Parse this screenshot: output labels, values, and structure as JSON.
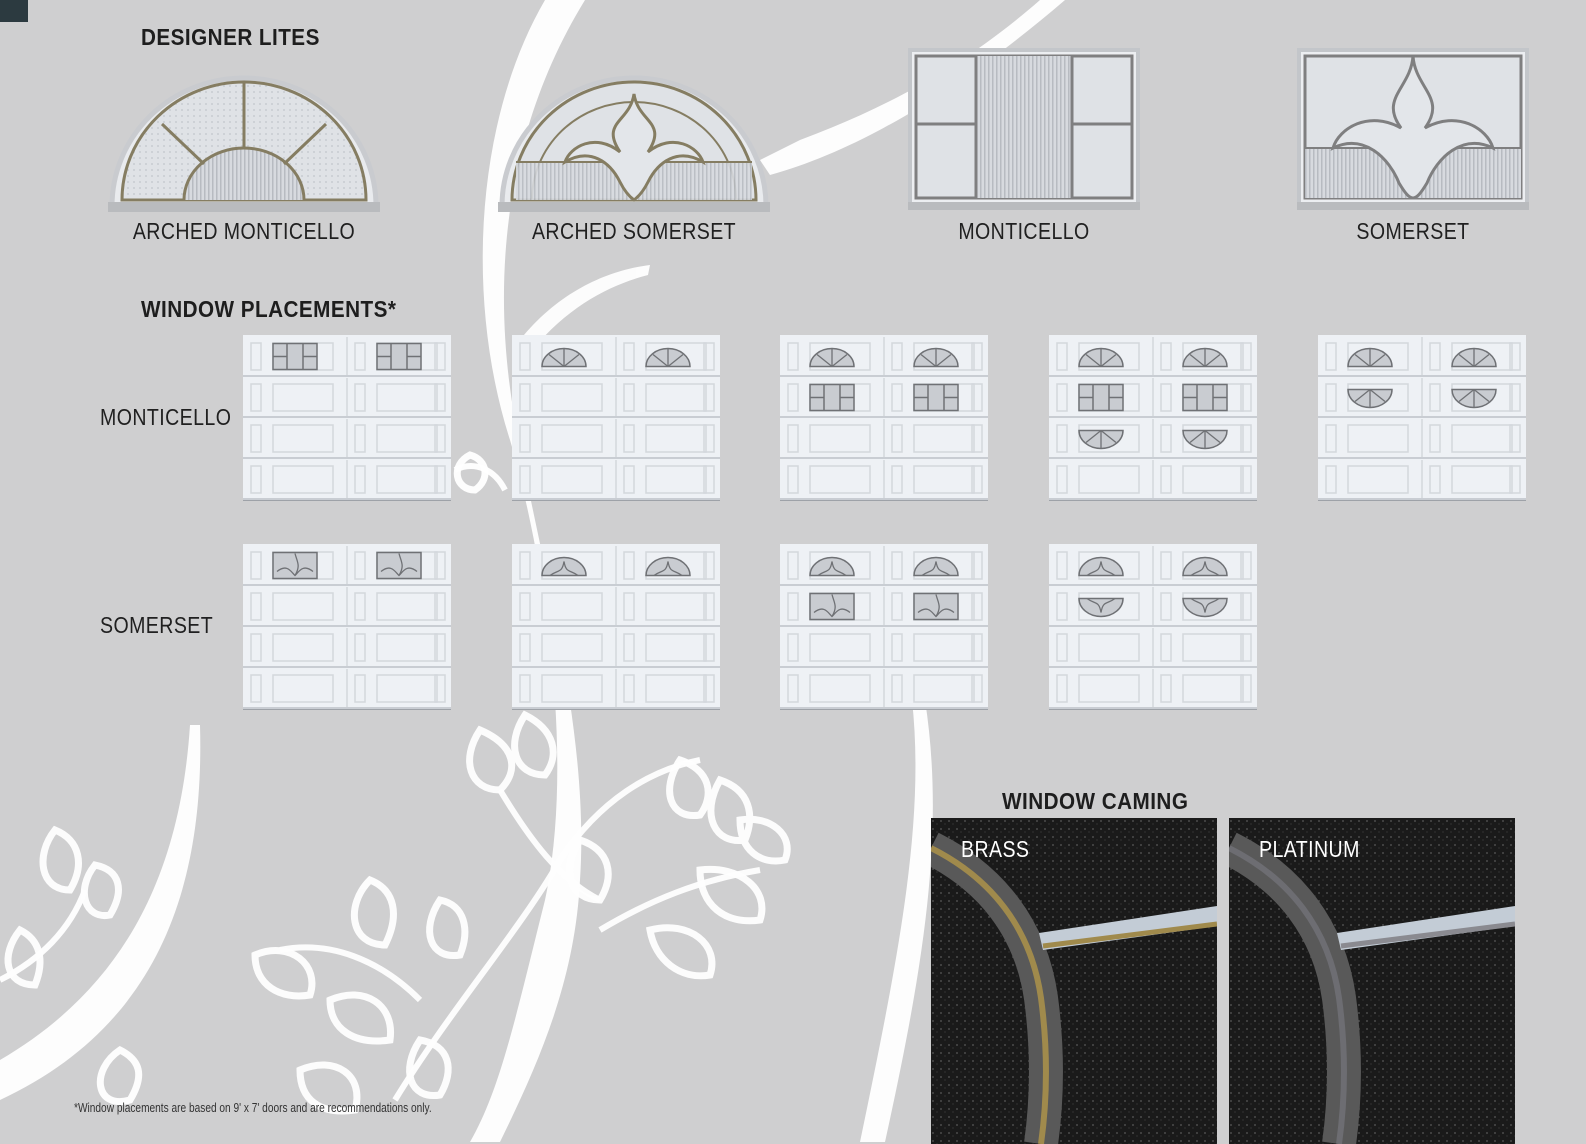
{
  "designer_lites": {
    "heading": "DESIGNER LITES",
    "items": [
      {
        "label": "ARCHED MONTICELLO",
        "shape": "arched",
        "pattern": "monticello"
      },
      {
        "label": "ARCHED SOMERSET",
        "shape": "arched",
        "pattern": "somerset"
      },
      {
        "label": "MONTICELLO",
        "shape": "rect",
        "pattern": "monticello"
      },
      {
        "label": "SOMERSET",
        "shape": "rect",
        "pattern": "somerset"
      }
    ]
  },
  "window_placements": {
    "heading": "WINDOW PLACEMENTS*",
    "rows": [
      {
        "label": "MONTICELLO",
        "style": "monticello",
        "doors": [
          [
            "rect"
          ],
          [
            "arch"
          ],
          [
            "arch",
            "rect"
          ],
          [
            "arch",
            "rect",
            "archdown"
          ],
          [
            "arch",
            "archdown"
          ]
        ]
      },
      {
        "label": "SOMERSET",
        "style": "somerset",
        "doors": [
          [
            "rect"
          ],
          [
            "arch"
          ],
          [
            "arch",
            "rect"
          ],
          [
            "arch",
            "archdown"
          ]
        ]
      }
    ]
  },
  "window_caming": {
    "heading": "WINDOW CAMING",
    "items": [
      {
        "label": "BRASS",
        "metal_color": "#a08a4c"
      },
      {
        "label": "PLATINUM",
        "metal_color": "#6d6d72"
      }
    ]
  },
  "footnote": "*Window placements are based on 9' x 7' doors and are recommendations only.",
  "colors": {
    "background": "#cfcfd0",
    "accent": "#2c3a40",
    "swatch_dark": "#161616"
  }
}
